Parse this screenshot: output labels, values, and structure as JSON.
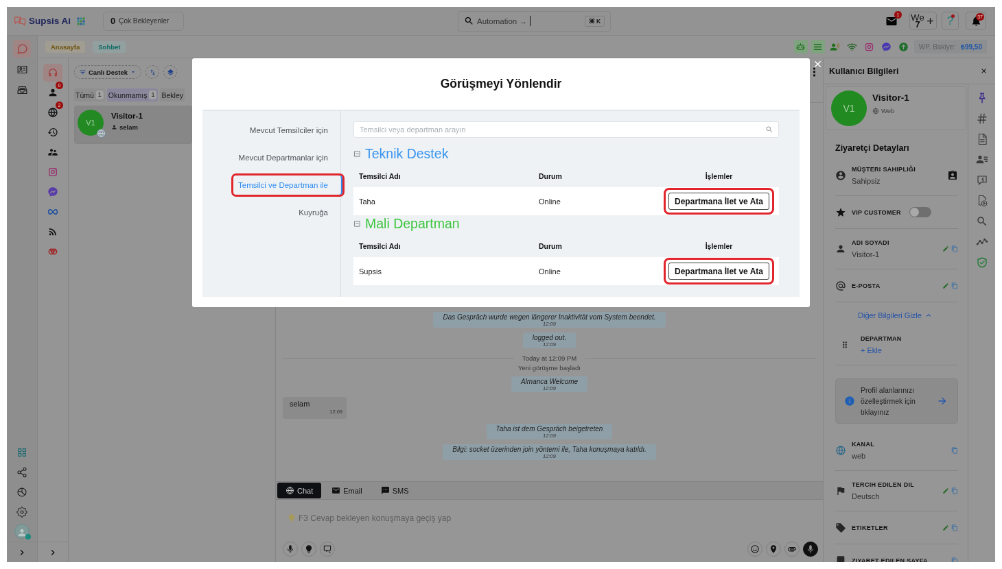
{
  "top_bar": {
    "logo": "Supsis Ai",
    "waiting": {
      "count": "0",
      "label": "Çok Bekleyenler"
    },
    "search": {
      "value": "Automation →",
      "focused": true,
      "shortcut": "⌘ K"
    },
    "mail_badge": "1",
    "workspace": {
      "label": "We",
      "number": "7"
    },
    "help": {
      "label": "?",
      "dot": true
    },
    "notifications_badge": "37"
  },
  "main_nav": [
    {
      "selected": true
    },
    {
      "selected": false
    },
    {
      "selected": false
    }
  ],
  "user": {
    "online": true
  },
  "breadcrumbs": [
    {
      "label": "Anasayfa",
      "color": "#6e5208"
    },
    {
      "label": "Sohbet",
      "color": "#0e6a64"
    }
  ],
  "channel_status": [
    {
      "active": true
    },
    {
      "active": true
    },
    {
      "active": false
    },
    {
      "active": false
    },
    {
      "active": false
    },
    {
      "active": false
    },
    {
      "active": false
    }
  ],
  "balance": {
    "label": "WP. Bakiye:",
    "value": "₺99,50"
  },
  "channel_filters": [
    {
      "selected": true
    },
    {
      "selected": false,
      "badge": "0"
    },
    {
      "selected": false,
      "badge": "2"
    },
    {
      "selected": false
    },
    {
      "selected": false
    },
    {
      "selected": false
    },
    {
      "selected": false
    },
    {
      "selected": false
    },
    {
      "selected": false
    },
    {
      "selected": false
    }
  ],
  "conversation_list": {
    "filter": "Canlı Destek",
    "tabs": [
      {
        "label": "Tümü",
        "count": "1",
        "selected": false
      },
      {
        "label": "Okunmamış",
        "count": "1",
        "selected": true
      },
      {
        "label": "Bekley",
        "selected": false
      }
    ],
    "conversations": [
      {
        "initials": "V1",
        "name": "Visitor-1",
        "preview": "selam",
        "selected": true
      }
    ]
  },
  "chat": {
    "messages": [
      {
        "kind": "system",
        "text": "Das Gespräch wurde wegen längerer Inaktivität vom System beendet.",
        "time": "12:09"
      },
      {
        "kind": "system",
        "text": "logged out.",
        "time": "12:09"
      },
      {
        "kind": "divider",
        "text": "Today at 12:09 PM"
      },
      {
        "kind": "notice",
        "text": "Yeni görüşme başladı"
      },
      {
        "kind": "system",
        "text": "Almanca Welcome",
        "time": "12:09"
      },
      {
        "kind": "incoming",
        "text": "selam",
        "time": "12:09"
      },
      {
        "kind": "system",
        "text": "Taha ist dem Gespräch beigetreten",
        "time": "12:09"
      },
      {
        "kind": "system",
        "text": "Bilgi: socket üzerinden join yöntemi ile, Taha konuşmaya katıldı.",
        "time": "12:09"
      }
    ],
    "channels": [
      {
        "label": "Chat",
        "selected": true
      },
      {
        "label": "Email",
        "selected": false
      },
      {
        "label": "SMS",
        "selected": false
      }
    ],
    "composer": {
      "placeholder": "F3 Cevap bekleyen konuşmaya geçiş yap"
    }
  },
  "modal": {
    "title": "Görüşmeyi Yönlendir",
    "nav": [
      {
        "label": "Mevcut Temsilciler için",
        "selected": false,
        "highlighted": false
      },
      {
        "label": "Mevcut Departmanlar için",
        "selected": false,
        "highlighted": false
      },
      {
        "label": "Temsilci ve Departman ile",
        "selected": true,
        "highlighted": true
      },
      {
        "label": "Kuyruğa",
        "selected": false,
        "highlighted": false
      }
    ],
    "search": {
      "placeholder": "Temsilci veya departman arayın"
    },
    "departments": [
      {
        "name": "Teknik Destek",
        "color": "#3a95ee",
        "expanded": true,
        "columns": [
          "Temsilci Adı",
          "Durum",
          "İşlemler"
        ],
        "rows": [
          {
            "agent": "Taha",
            "status": "Online",
            "action": "Departmana İlet ve Ata",
            "highlighted": true
          }
        ]
      },
      {
        "name": "Mali Departman",
        "color": "#3ec53e",
        "expanded": true,
        "columns": [
          "Temsilci Adı",
          "Durum",
          "İşlemler"
        ],
        "rows": [
          {
            "agent": "Supsis",
            "status": "Online",
            "action": "Departmana İlet ve Ata",
            "highlighted": true
          }
        ]
      }
    ]
  },
  "user_panel": {
    "title": "Kullanıcı Bilgileri",
    "visitor": {
      "initials": "V1",
      "name": "Visitor-1",
      "channel": "Web"
    },
    "section_title": "Ziyaretçi Detayları",
    "fields": [
      {
        "kind": "field",
        "label": "MÜŞTERI SAHIPLIĞI",
        "value": "Sahipsiz",
        "edit": false,
        "copy": false
      },
      {
        "kind": "toggle",
        "label": "VIP CUSTOMER",
        "on": false
      },
      {
        "kind": "field",
        "label": "ADI SOYADI",
        "value": "Visitor-1",
        "edit": true,
        "copy": true
      },
      {
        "kind": "field",
        "label": "E-POSTA",
        "edit": true,
        "copy": true
      },
      {
        "kind": "link",
        "label": "Diğer Bilgileri Gizle",
        "expanded": true
      },
      {
        "kind": "field",
        "label": "DEPARTMAN",
        "add": "+ Ekle",
        "edit": false,
        "copy": false
      },
      {
        "kind": "info",
        "text": "Profil alanlarınızı özelleştirmek için tıklayınız"
      },
      {
        "kind": "field",
        "label": "KANAL",
        "value": "web",
        "edit": false,
        "copy": true
      },
      {
        "kind": "field",
        "label": "TERCIH EDILEN DIL",
        "value": "Deutsch",
        "edit": true,
        "copy": true
      },
      {
        "kind": "field",
        "label": "ETIKETLER",
        "edit": true,
        "copy": true
      },
      {
        "kind": "field",
        "label": "ZIYARET EDILEN SAYFA",
        "edit": false,
        "copy": true
      }
    ]
  }
}
